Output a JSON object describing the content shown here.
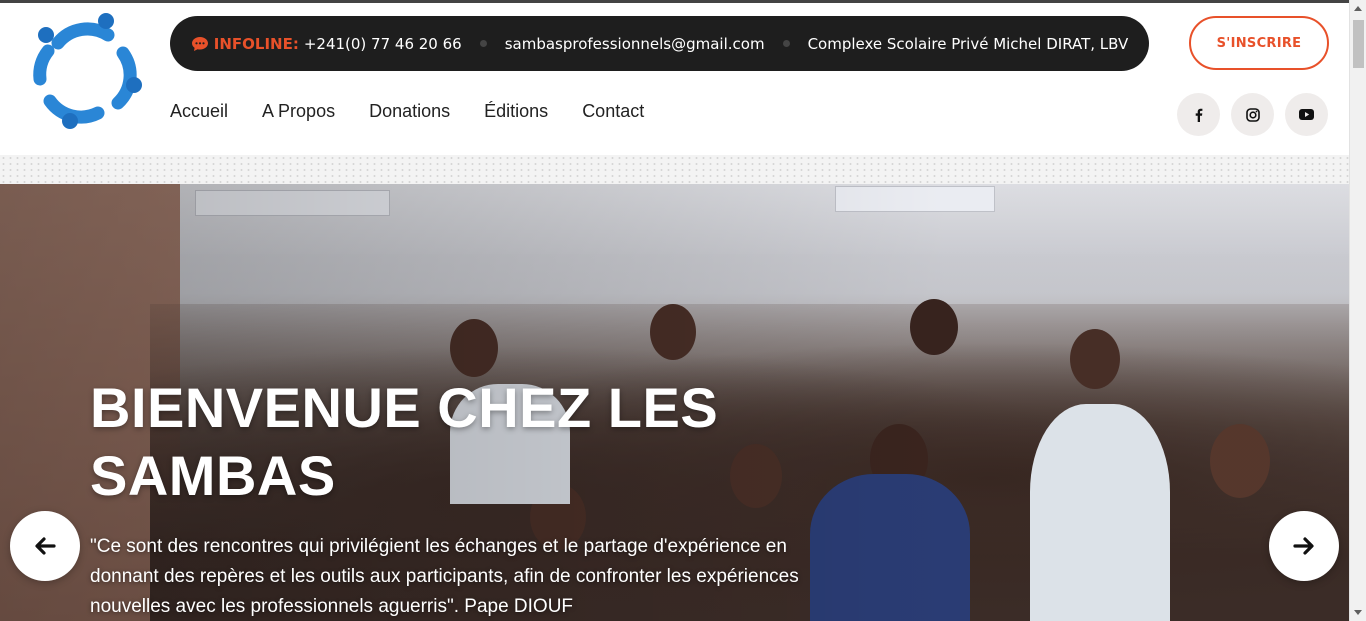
{
  "header": {
    "infobar": {
      "infoline_label": "INFOLINE:",
      "phone": "+241(0) 77 46 20 66",
      "email": "sambasprofessionnels@gmail.com",
      "address": "Complexe Scolaire Privé Michel DIRAT, LBV"
    },
    "cta_label": "S'INSCRIRE",
    "nav": [
      {
        "label": "Accueil"
      },
      {
        "label": "A Propos"
      },
      {
        "label": "Donations"
      },
      {
        "label": "Éditions"
      },
      {
        "label": "Contact"
      }
    ],
    "social": [
      {
        "icon": "facebook-icon",
        "glyph": "f"
      },
      {
        "icon": "instagram-icon"
      },
      {
        "icon": "youtube-icon"
      }
    ]
  },
  "hero": {
    "title": "BIENVENUE CHEZ LES SAMBAS",
    "quote": "\"Ce sont des rencontres qui privilégient les échanges et le partage d'expérience en donnant des repères et les outils aux participants, afin de confronter les expériences nouvelles avec les professionnels aguerris\". Pape DIOUF"
  },
  "colors": {
    "accent": "#e8512a",
    "infobar_bg": "#1e1e1e",
    "logo_blue": "#2a86d6"
  }
}
